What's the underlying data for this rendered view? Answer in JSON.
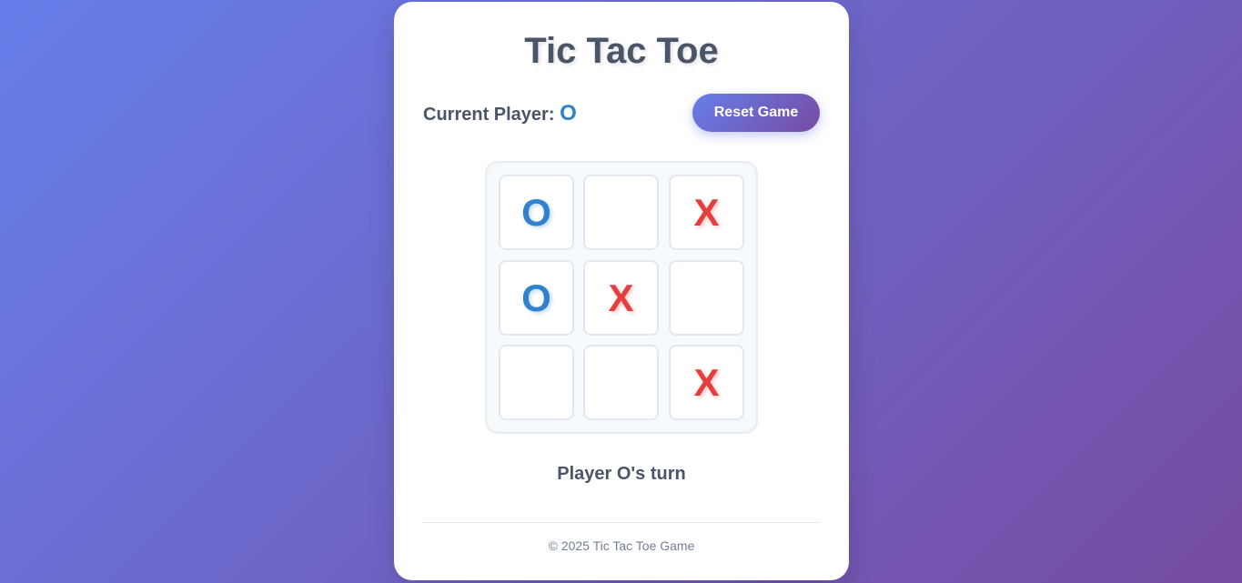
{
  "title": "Tic Tac Toe",
  "current_player": {
    "label": "Current Player:",
    "mark": "O"
  },
  "reset_label": "Reset Game",
  "board": {
    "cells": [
      "O",
      "",
      "X",
      "O",
      "X",
      "",
      "",
      "",
      "X"
    ]
  },
  "status": "Player O's turn",
  "footer": "© 2025 Tic Tac Toe Game",
  "colors": {
    "background_start": "#667eea",
    "background_end": "#764ba2",
    "x_color": "#e53e3e",
    "o_color": "#3182ce",
    "text": "#4a5568"
  }
}
